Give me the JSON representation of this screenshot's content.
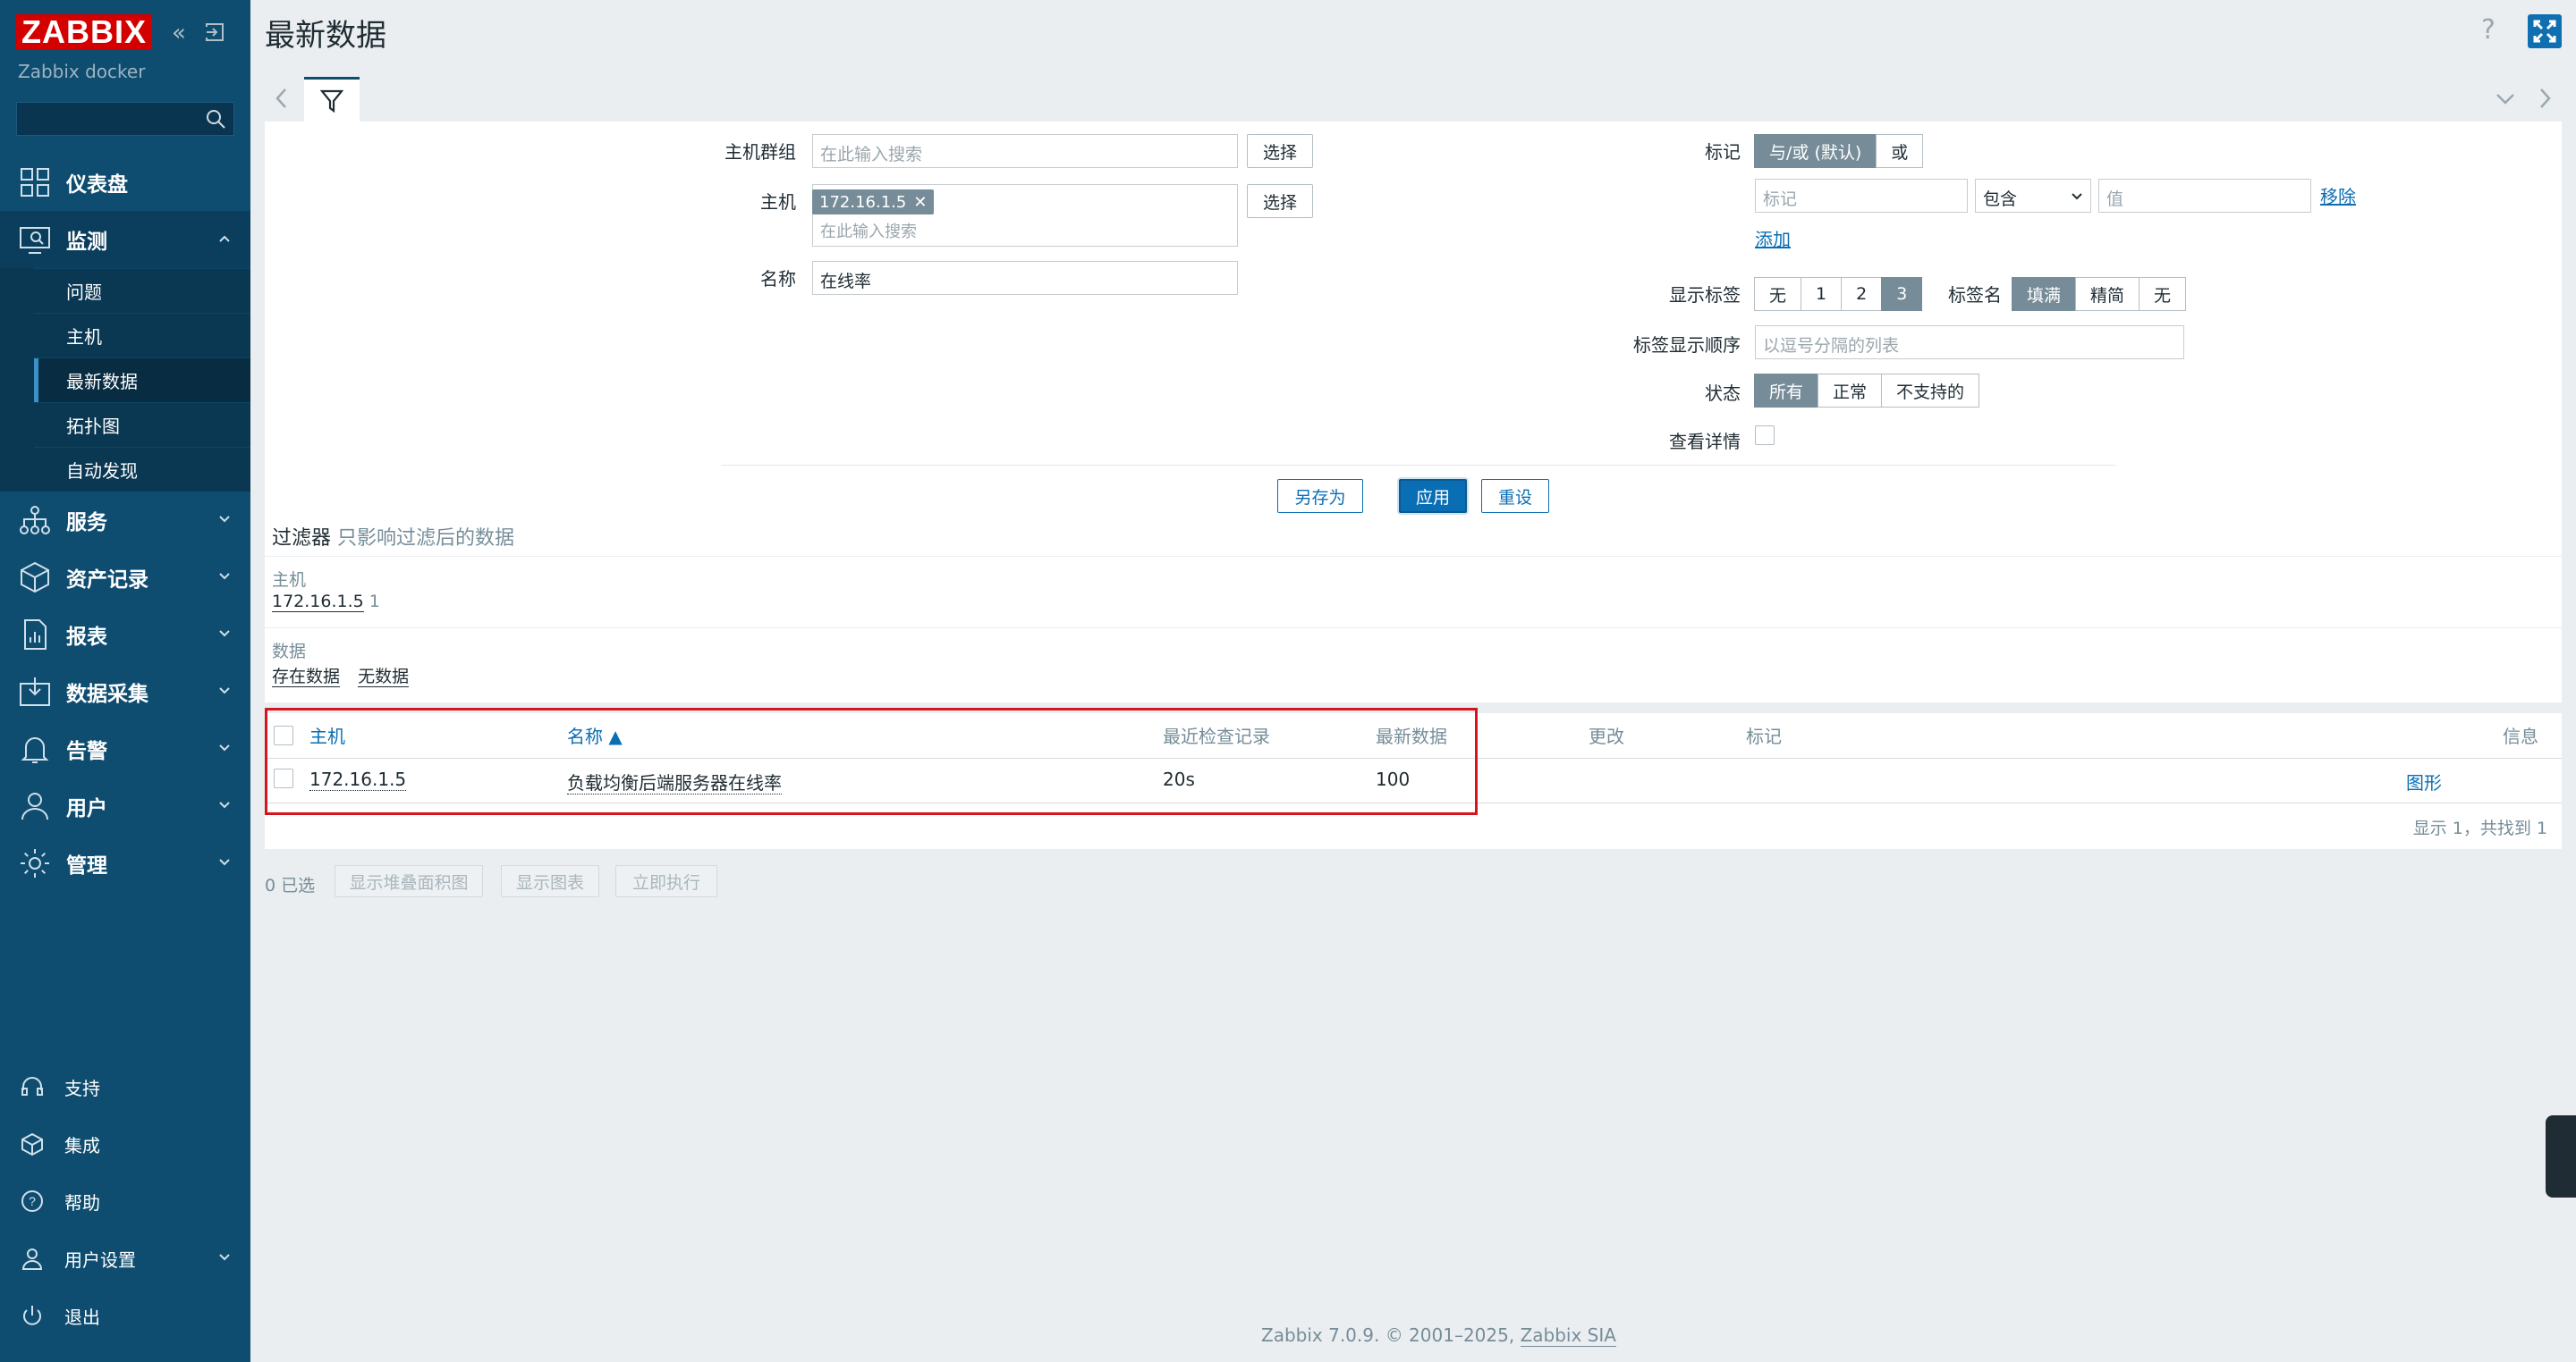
{
  "app": {
    "logo": "ZABBIX",
    "server_name": "Zabbix docker"
  },
  "sidebar": {
    "menu": [
      {
        "label": "仪表盘",
        "icon": "dashboard-icon"
      },
      {
        "label": "监测",
        "icon": "monitoring-icon",
        "expanded": true,
        "children": [
          "问题",
          "主机",
          "最新数据",
          "拓扑图",
          "自动发现"
        ],
        "selected": "最新数据"
      },
      {
        "label": "服务",
        "icon": "services-icon"
      },
      {
        "label": "资产记录",
        "icon": "inventory-icon"
      },
      {
        "label": "报表",
        "icon": "reports-icon"
      },
      {
        "label": "数据采集",
        "icon": "data-collection-icon"
      },
      {
        "label": "告警",
        "icon": "alerts-icon"
      },
      {
        "label": "用户",
        "icon": "users-icon"
      },
      {
        "label": "管理",
        "icon": "administration-icon"
      }
    ],
    "bottom": [
      {
        "label": "支持",
        "icon": "support-icon"
      },
      {
        "label": "集成",
        "icon": "integrations-icon"
      },
      {
        "label": "帮助",
        "icon": "help-icon"
      },
      {
        "label": "用户设置",
        "icon": "user-settings-icon"
      },
      {
        "label": "退出",
        "icon": "signout-icon"
      }
    ]
  },
  "header": {
    "title": "最新数据",
    "help": "?"
  },
  "filter": {
    "host_group_label": "主机群组",
    "host_group_placeholder": "在此输入搜索",
    "select_label": "选择",
    "host_label": "主机",
    "host_chip": "172.16.1.5",
    "host_placeholder": "在此输入搜索",
    "name_label": "名称",
    "name_value": "在线率",
    "tags_label": "标记",
    "tag_mode_options": [
      "与/或 (默认)",
      "或"
    ],
    "tag_mode_selected": "与/或 (默认)",
    "tag_placeholder": "标记",
    "tag_operator": "包含",
    "tag_value_placeholder": "值",
    "remove_label": "移除",
    "add_label": "添加",
    "show_tags_label": "显示标签",
    "show_tags_options": [
      "无",
      "1",
      "2",
      "3"
    ],
    "show_tags_selected": "3",
    "tag_name_label": "标签名",
    "tag_name_options": [
      "填满",
      "精简",
      "无"
    ],
    "tag_name_selected": "填满",
    "tag_priority_label": "标签显示顺序",
    "tag_priority_placeholder": "以逗号分隔的列表",
    "state_label": "状态",
    "state_options": [
      "所有",
      "正常",
      "不支持的"
    ],
    "state_selected": "所有",
    "show_details_label": "查看详情",
    "save_as": "另存为",
    "apply": "应用",
    "reset": "重设"
  },
  "summary": {
    "title": "过滤器",
    "desc": "只影响过滤后的数据",
    "host_group": "主机",
    "host_value": "172.16.1.5",
    "host_count": "1",
    "data_group": "数据",
    "with_data": "存在数据",
    "without_data": "无数据"
  },
  "table": {
    "headers": [
      "主机",
      "名称 ▲",
      "最近检查记录",
      "最新数据",
      "更改",
      "标记",
      "信息"
    ],
    "rows": [
      {
        "host": "172.16.1.5",
        "name": "负载均衡后端服务器在线率",
        "last_check": "20s",
        "last_value": "100",
        "change": "",
        "tags": "",
        "action": "图形"
      }
    ],
    "footer": "显示 1，共找到 1"
  },
  "actions": {
    "selected": "0 已选",
    "stacked_graph": "显示堆叠面积图",
    "graph": "显示图表",
    "execute_now": "立即执行"
  },
  "footer": {
    "text": "Zabbix 7.0.9. © 2001–2025,",
    "company": "Zabbix SIA"
  }
}
